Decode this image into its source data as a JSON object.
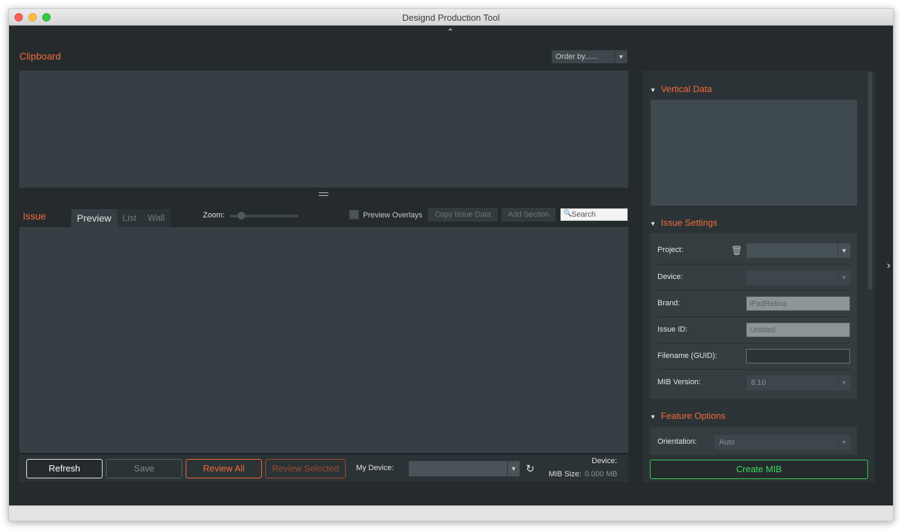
{
  "window": {
    "title": "Designd Production Tool"
  },
  "clipboard": {
    "label": "Clipboard",
    "order_by": "Order by......"
  },
  "issue": {
    "label": "Issue",
    "tabs": [
      {
        "label": "Preview",
        "active": true
      },
      {
        "label": "List",
        "active": false
      },
      {
        "label": "Wall",
        "active": false
      }
    ],
    "zoom_label": "Zoom:",
    "preview_overlays_label": "Preview Overlays",
    "copy_issue_data": "Copy Issue Data",
    "add_section": "Add Section",
    "search_placeholder": "Search"
  },
  "bottom": {
    "refresh": "Refresh",
    "save": "Save",
    "review_all": "Review All",
    "review_selected": "Review Selected",
    "my_device_label": "My Device:",
    "device_label": "Device:",
    "mib_size_label": "MIB Size:",
    "mib_size_value": "0.000 MB"
  },
  "right_panel": {
    "vertical_data_title": "Vertical Data",
    "issue_settings_title": "Issue Settings",
    "project_label": "Project:",
    "device_label": "Device:",
    "brand_label": "Brand:",
    "brand_value": "iPadRetina",
    "issue_id_label": "Issue ID:",
    "issue_id_value": "Untitled",
    "filename_label": "Filename (GUID):",
    "mib_version_label": "MIB Version:",
    "mib_version_value": "8.10",
    "feature_options_title": "Feature Options",
    "orientation_label": "Orientation:",
    "orientation_value": "Auto",
    "create_mib": "Create MIB"
  },
  "colors": {
    "accent": "#f26b3a",
    "create_green": "#34d455",
    "background": "#252b2d"
  }
}
